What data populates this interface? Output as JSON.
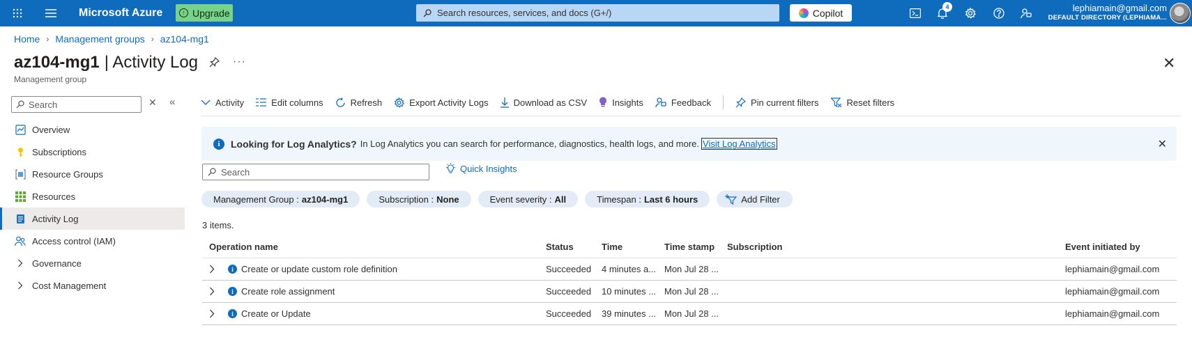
{
  "topbar": {
    "brand": "Microsoft Azure",
    "upgrade_label": "Upgrade",
    "search_placeholder": "Search resources, services, and docs (G+/)",
    "copilot_label": "Copilot",
    "notification_count": "4",
    "user_email": "lephiamain@gmail.com",
    "user_directory": "DEFAULT DIRECTORY (LEPHIAMA...",
    "accent_color": "#0f6cbd"
  },
  "breadcrumb": [
    "Home",
    "Management groups",
    "az104-mg1"
  ],
  "page": {
    "title_resource": "az104-mg1",
    "title_section": "| Activity Log",
    "subtitle": "Management group",
    "more": "···"
  },
  "sidebar": {
    "search_placeholder": "Search",
    "items": [
      {
        "label": "Overview",
        "icon": "overview-icon"
      },
      {
        "label": "Subscriptions",
        "icon": "key-icon"
      },
      {
        "label": "Resource Groups",
        "icon": "resource-group-icon"
      },
      {
        "label": "Resources",
        "icon": "grid-icon"
      },
      {
        "label": "Activity Log",
        "icon": "activity-log-icon",
        "active": true
      },
      {
        "label": "Access control (IAM)",
        "icon": "people-icon"
      },
      {
        "label": "Governance",
        "icon": "chevron-right-icon"
      },
      {
        "label": "Cost Management",
        "icon": "chevron-right-icon"
      }
    ]
  },
  "toolbar": {
    "activity": "Activity",
    "edit_columns": "Edit columns",
    "refresh": "Refresh",
    "export": "Export Activity Logs",
    "download": "Download as CSV",
    "insights": "Insights",
    "feedback": "Feedback",
    "pin_filters": "Pin current filters",
    "reset_filters": "Reset filters"
  },
  "infobar": {
    "heading": "Looking for Log Analytics?",
    "text": "In Log Analytics you can search for performance, diagnostics, health logs, and more.",
    "link": "Visit Log Analytics"
  },
  "search": {
    "placeholder": "Search",
    "quick_insights": "Quick Insights"
  },
  "filters": [
    {
      "label": "Management Group :",
      "value": "az104-mg1"
    },
    {
      "label": "Subscription :",
      "value": "None"
    },
    {
      "label": "Event severity :",
      "value": "All"
    },
    {
      "label": "Timespan :",
      "value": "Last 6 hours"
    }
  ],
  "add_filter": "Add Filter",
  "item_count": "3 items.",
  "table": {
    "columns": [
      "Operation name",
      "Status",
      "Time",
      "Time stamp",
      "Subscription",
      "Event initiated by"
    ],
    "rows": [
      {
        "operation": "Create or update custom role definition",
        "status": "Succeeded",
        "time": "4 minutes a...",
        "timestamp": "Mon Jul 28 ...",
        "subscription": "",
        "initiated_by": "lephiamain@gmail.com"
      },
      {
        "operation": "Create role assignment",
        "status": "Succeeded",
        "time": "10 minutes ...",
        "timestamp": "Mon Jul 28 ...",
        "subscription": "",
        "initiated_by": "lephiamain@gmail.com"
      },
      {
        "operation": "Create or Update",
        "status": "Succeeded",
        "time": "39 minutes ...",
        "timestamp": "Mon Jul 28 ...",
        "subscription": "",
        "initiated_by": "lephiamain@gmail.com"
      }
    ]
  }
}
